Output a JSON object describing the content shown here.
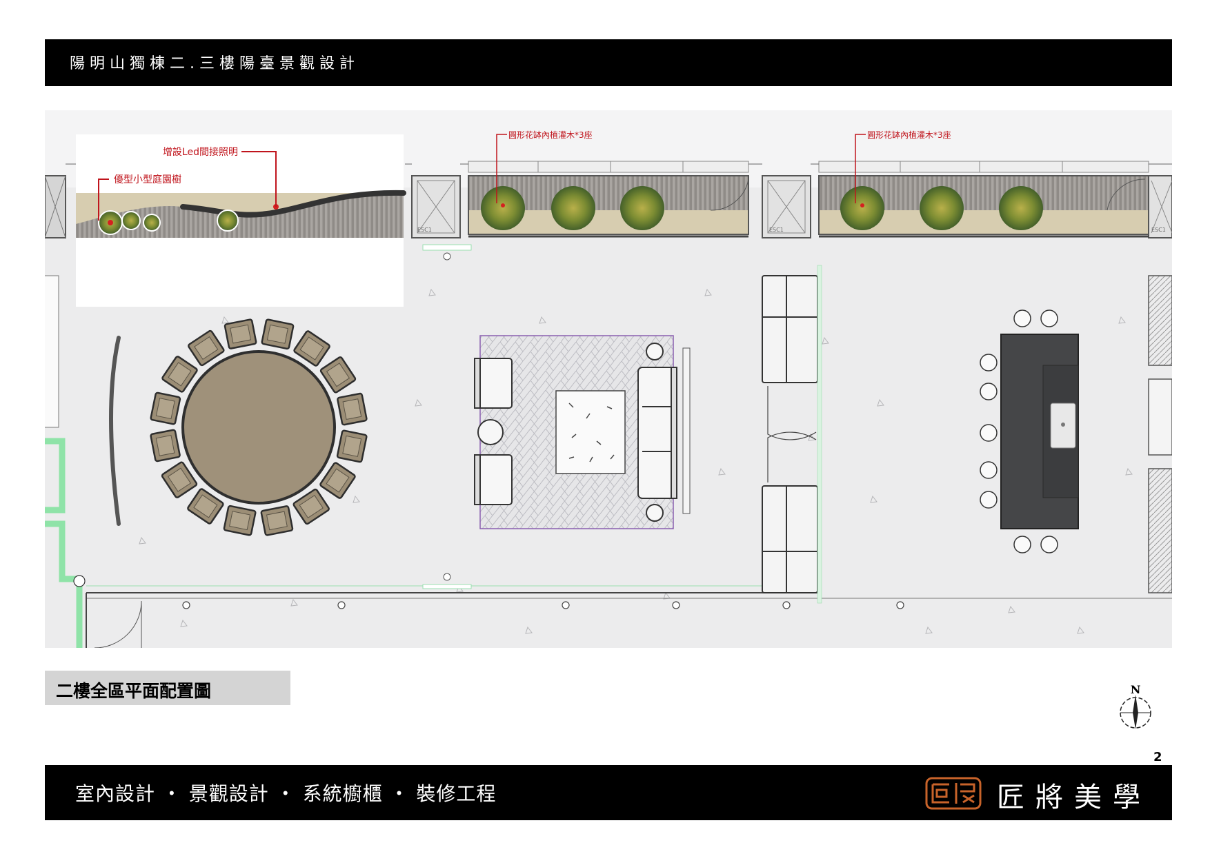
{
  "header": {
    "title": "陽明山獨棟二.三樓陽臺景觀設計"
  },
  "plan": {
    "annotations": {
      "led_lighting": "增設Led間接照明",
      "garden_tree": "優型小型庭園樹",
      "planter_left": "圓形花缽內植灌木*3座",
      "planter_right": "圓形花缽內植灌木*3座"
    },
    "door_tags": [
      "ESC1",
      "ESC1",
      "ESC1",
      "ESC1"
    ]
  },
  "caption": {
    "text": "二樓全區平面配置圖"
  },
  "compass": {
    "label": "N"
  },
  "page_number": "2",
  "footer": {
    "services": "室內設計 ・ 景觀設計 ・ 系統櫥櫃 ・ 裝修工程",
    "brand": "匠將美學"
  },
  "colors": {
    "floor": "#ececed",
    "deck": "#d7cdb0",
    "table": "#9f917a",
    "island": "#454648",
    "accent_green": "#8fe3a8",
    "annotation_red": "#c0141c"
  }
}
